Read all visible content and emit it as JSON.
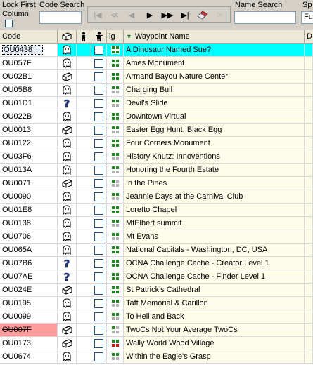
{
  "toolbar": {
    "lock_first_label": "Lock First",
    "column_label": "Column",
    "code_search_label": "Code Search",
    "code_search_value": "",
    "name_search_label": "Name Search",
    "name_search_value": "",
    "sp_label": "Sp",
    "sp_value": "Fu"
  },
  "grid": {
    "headers": {
      "code": "Code",
      "type": "type-icon",
      "found": "found-person-icon",
      "dnf": "person-icon",
      "lg": "lg",
      "name": "Waypoint Name",
      "d": "D"
    },
    "rows": [
      {
        "code": "OU0438",
        "icon": "ghost",
        "lg": "gggg",
        "name": "A Dinosaur Named Sue?"
      },
      {
        "code": "OU057F",
        "icon": "ghost",
        "lg": "gggg",
        "name": "Ames Monument"
      },
      {
        "code": "OU02B1",
        "icon": "box",
        "lg": "gggg",
        "name": "Armand Bayou Nature Center"
      },
      {
        "code": "OU05B8",
        "icon": "ghost",
        "lg": "ggyy",
        "name": "Charging Bull"
      },
      {
        "code": "OU01D1",
        "icon": "question",
        "lg": "ggyy",
        "name": "Devil's Slide"
      },
      {
        "code": "OU022B",
        "icon": "ghost",
        "lg": "gggg",
        "name": "Downtown Virtual"
      },
      {
        "code": "OU0013",
        "icon": "box",
        "lg": "ggyy",
        "name": "Easter Egg Hunt: Black Egg"
      },
      {
        "code": "OU0122",
        "icon": "ghost",
        "lg": "gggg",
        "name": "Four Corners Monument"
      },
      {
        "code": "OU03F6",
        "icon": "ghost",
        "lg": "ggyy",
        "name": "History Knutz: Innoventions"
      },
      {
        "code": "OU013A",
        "icon": "ghost",
        "lg": "ggyy",
        "name": "Honoring the Fourth Estate"
      },
      {
        "code": "OU0071",
        "icon": "box",
        "lg": "gyyy",
        "name": "In the Pines"
      },
      {
        "code": "OU0090",
        "icon": "ghost",
        "lg": "ggyy",
        "name": "Jeannie Days at the Carnival Club"
      },
      {
        "code": "OU01E8",
        "icon": "ghost",
        "lg": "gggg",
        "name": "Loretto Chapel"
      },
      {
        "code": "OU0138",
        "icon": "ghost",
        "lg": "ggyy",
        "name": "MtElbert summit"
      },
      {
        "code": "OU0706",
        "icon": "ghost",
        "lg": "ggyy",
        "name": "Mt Evans"
      },
      {
        "code": "OU065A",
        "icon": "ghost",
        "lg": "gggg",
        "name": "National Capitals - Washington, DC, USA"
      },
      {
        "code": "OU07B6",
        "icon": "question",
        "lg": "gggg",
        "name": "OCNA Challenge Cache - Creator Level 1"
      },
      {
        "code": "OU07AE",
        "icon": "question",
        "lg": "gggg",
        "name": "OCNA Challenge Cache - Finder Level 1"
      },
      {
        "code": "OU024E",
        "icon": "box",
        "lg": "gggg",
        "name": "St Patrick's Cathedral"
      },
      {
        "code": "OU0195",
        "icon": "ghost",
        "lg": "ggyy",
        "name": "Taft Memorial & Carillon"
      },
      {
        "code": "OU0099",
        "icon": "ghost",
        "lg": "ggyy",
        "name": "To Hell and Back"
      },
      {
        "code": "OU007F",
        "icon": "box",
        "lg": "gyyy",
        "name": "TwoCs Not Your Average TwoCs"
      },
      {
        "code": "OU0173",
        "icon": "box",
        "lg": "ggrr",
        "name": "Wally World Wood Village"
      },
      {
        "code": "OU0674",
        "icon": "ghost",
        "lg": "ggyy",
        "name": "Within the Eagle's Grasp"
      }
    ]
  }
}
